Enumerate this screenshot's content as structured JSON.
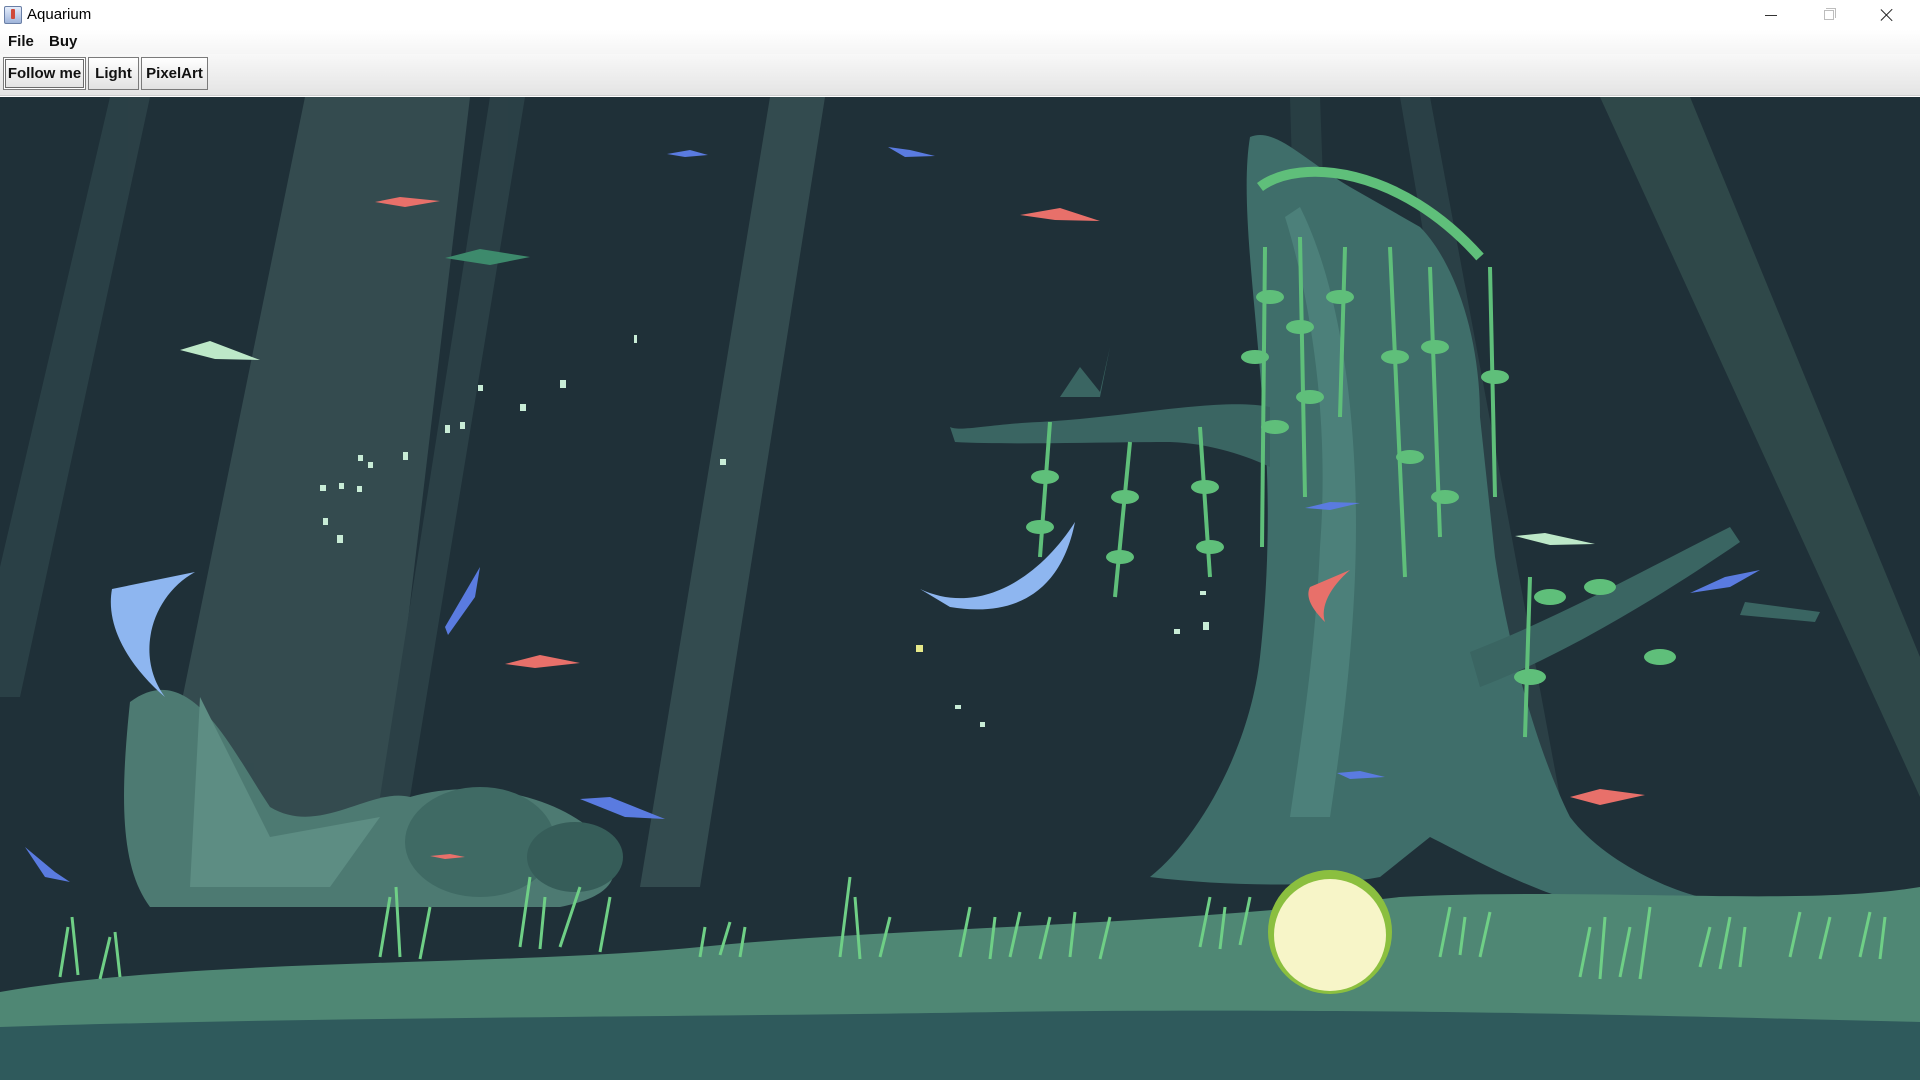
{
  "window": {
    "title": "Aquarium",
    "controls": [
      "minimize-icon",
      "maximize-icon",
      "close-icon"
    ]
  },
  "menubar": {
    "items": [
      {
        "label": "File"
      },
      {
        "label": "Buy"
      }
    ]
  },
  "toolbar": {
    "buttons": [
      {
        "label": "Follow me",
        "focused": true
      },
      {
        "label": "Light"
      },
      {
        "label": "PixelArt"
      }
    ]
  },
  "scene": {
    "palette": {
      "water": "#1f3038",
      "light_ray": "#3b5457",
      "ground": "#4f8774",
      "trunk": "#3f6e6a",
      "leaf": "#5fbf7a",
      "fish_red": "#e8706a",
      "fish_blue": "#5a7be0",
      "fish_light_blue": "#8eb6f0",
      "fish_green": "#3d8a6c",
      "fish_mint": "#bde8c8",
      "food_pellet": "#f7f5c8"
    },
    "objects": [
      "light-rays",
      "rock-pile",
      "tree-stump",
      "hanging-vines",
      "grass",
      "fish",
      "bubbles",
      "food-pellet"
    ]
  }
}
